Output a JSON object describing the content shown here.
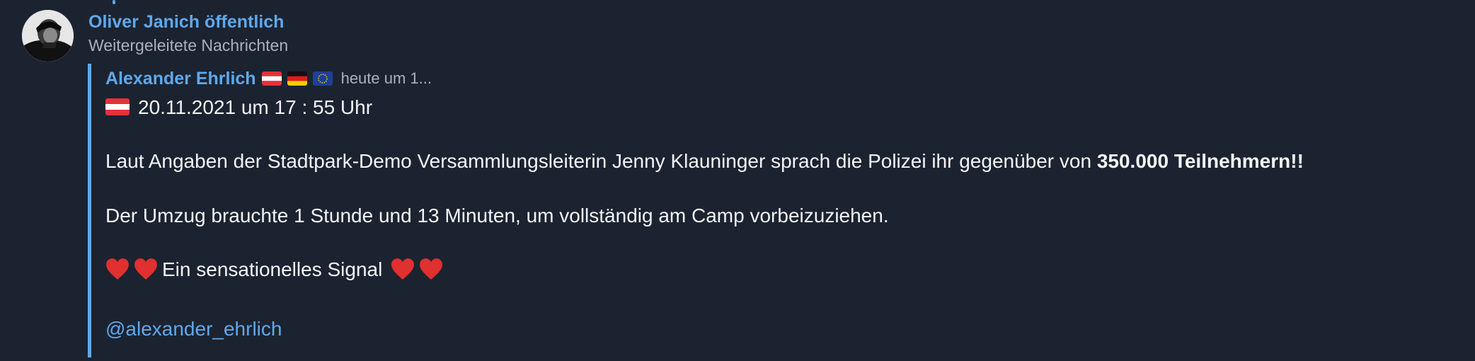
{
  "header": {
    "channel_name": "Oliver Janich öffentlich",
    "subtitle": "Weitergeleitete Nachrichten"
  },
  "forwarded": {
    "author": "Alexander Ehrlich",
    "flags": [
      "austria-flag",
      "germany-flag",
      "eu-flag"
    ],
    "time": "heute um 1..."
  },
  "message": {
    "line1": "20.11.2021 um 17 : 55 Uhr",
    "line2_text": "Laut Angaben der Stadtpark-Demo Versammlungsleiterin Jenny Klauninger sprach die Polizei ihr gegenüber von ",
    "line2_bold": "350.000 Teilnehmern!!",
    "line3": "Der Umzug brauchte 1 Stunde und 13 Minuten, um vollständig am Camp vorbeizuziehen.",
    "line4": "Ein sensationelles Signal",
    "mention": "@alexander_ehrlich"
  },
  "colors": {
    "background": "#1c2330",
    "accent": "#5ea9ee",
    "text": "#f2f4f7",
    "muted": "#a9b1bc"
  }
}
